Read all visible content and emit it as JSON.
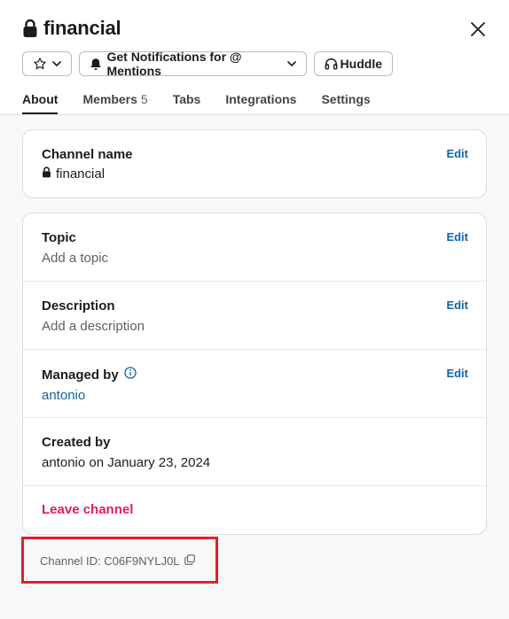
{
  "header": {
    "title": "financial",
    "notifications_label": "Get Notifications for @ Mentions",
    "huddle_label": "Huddle"
  },
  "tabs": [
    {
      "label": "About",
      "count": ""
    },
    {
      "label": "Members",
      "count": "5"
    },
    {
      "label": "Tabs",
      "count": ""
    },
    {
      "label": "Integrations",
      "count": ""
    },
    {
      "label": "Settings",
      "count": ""
    }
  ],
  "channel_name": {
    "label": "Channel name",
    "value": "financial",
    "edit_label": "Edit"
  },
  "details": {
    "topic": {
      "label": "Topic",
      "value": "Add a topic",
      "edit_label": "Edit"
    },
    "description": {
      "label": "Description",
      "value": "Add a description",
      "edit_label": "Edit"
    },
    "managed_by": {
      "label": "Managed by",
      "value": "antonio",
      "edit_label": "Edit"
    },
    "created_by": {
      "label": "Created by",
      "value": "antonio on January 23, 2024"
    },
    "leave_label": "Leave channel"
  },
  "footer": {
    "channel_id_text": "Channel ID: C06F9NYLJ0L"
  },
  "colors": {
    "link": "#1264a3",
    "danger": "#e01e5a",
    "highlight": "#e41e2b"
  },
  "icons": [
    "lock-icon",
    "close-icon",
    "star-icon",
    "chevron-down-icon",
    "bell-icon",
    "headphones-icon",
    "info-icon",
    "copy-icon"
  ]
}
